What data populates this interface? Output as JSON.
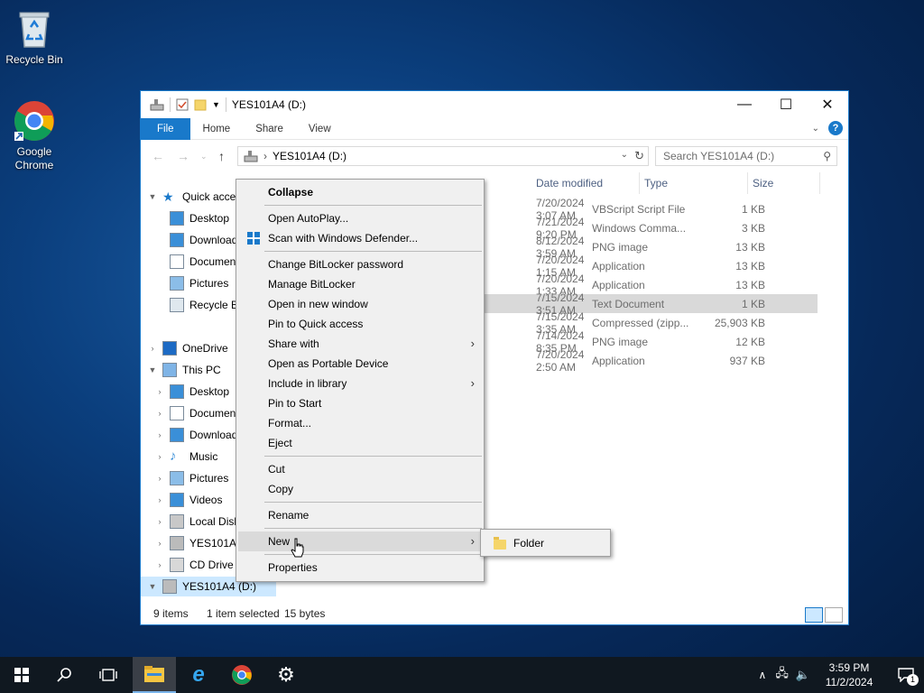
{
  "desktop": {
    "icons": [
      {
        "label": "Recycle Bin",
        "icon": "recycle-bin-icon"
      },
      {
        "label": "Google Chrome",
        "icon": "chrome-icon"
      }
    ]
  },
  "window": {
    "title": "YES101A4 (D:)",
    "tabs": [
      "File",
      "Home",
      "Share",
      "View"
    ],
    "address": "YES101A4 (D:)",
    "search_placeholder": "Search YES101A4 (D:)",
    "columns": {
      "date": "Date modified",
      "type": "Type",
      "size": "Size"
    },
    "files": [
      {
        "date": "7/20/2024 3:07 AM",
        "type": "VBScript Script File",
        "size": "1 KB"
      },
      {
        "date": "7/21/2024 9:20 PM",
        "type": "Windows Comma...",
        "size": "3 KB"
      },
      {
        "date": "8/12/2024 3:59 AM",
        "type": "PNG image",
        "size": "13 KB"
      },
      {
        "date": "7/20/2024 1:15 AM",
        "type": "Application",
        "size": "13 KB"
      },
      {
        "date": "7/20/2024 1:33 AM",
        "type": "Application",
        "size": "13 KB"
      },
      {
        "date": "7/15/2024 3:51 AM",
        "type": "Text Document",
        "size": "1 KB",
        "selected": true
      },
      {
        "date": "7/15/2024 3:35 AM",
        "type": "Compressed (zipp...",
        "size": "25,903 KB"
      },
      {
        "date": "7/14/2024 8:35 PM",
        "type": "PNG image",
        "size": "12 KB"
      },
      {
        "date": "7/20/2024 2:50 AM",
        "type": "Application",
        "size": "937 KB"
      }
    ],
    "nav": [
      {
        "label": "Quick access",
        "level": 0,
        "arrow": "▼",
        "icon": "star-icon"
      },
      {
        "label": "Desktop",
        "level": 1,
        "arrow": "",
        "icon": "desktop-icon"
      },
      {
        "label": "Downloads",
        "level": 1,
        "arrow": "",
        "icon": "download-icon"
      },
      {
        "label": "Documents",
        "level": 1,
        "arrow": "",
        "icon": "document-icon"
      },
      {
        "label": "Pictures",
        "level": 1,
        "arrow": "",
        "icon": "pictures-icon"
      },
      {
        "label": "Recycle Bin",
        "level": 1,
        "arrow": "",
        "icon": "recycle-bin-icon"
      },
      {
        "label": "",
        "level": 0,
        "arrow": "",
        "icon": ""
      },
      {
        "label": "OneDrive",
        "level": 0,
        "arrow": "›",
        "icon": "onedrive-icon"
      },
      {
        "label": "This PC",
        "level": 0,
        "arrow": "▼",
        "icon": "pc-icon"
      },
      {
        "label": "Desktop",
        "level": 1,
        "arrow": "›",
        "icon": "desktop-icon"
      },
      {
        "label": "Documents",
        "level": 1,
        "arrow": "›",
        "icon": "document-icon"
      },
      {
        "label": "Downloads",
        "level": 1,
        "arrow": "›",
        "icon": "download-icon"
      },
      {
        "label": "Music",
        "level": 1,
        "arrow": "›",
        "icon": "music-icon"
      },
      {
        "label": "Pictures",
        "level": 1,
        "arrow": "›",
        "icon": "pictures-icon"
      },
      {
        "label": "Videos",
        "level": 1,
        "arrow": "›",
        "icon": "videos-icon"
      },
      {
        "label": "Local Disk (C:)",
        "level": 1,
        "arrow": "›",
        "icon": "drive-icon"
      },
      {
        "label": "YES101A4 (D:)",
        "level": 1,
        "arrow": "›",
        "icon": "usb-drive-icon"
      },
      {
        "label": "CD Drive (E:)",
        "level": 1,
        "arrow": "›",
        "icon": "cd-drive-icon"
      },
      {
        "label": "YES101A4 (D:)",
        "level": 0,
        "arrow": "▼",
        "icon": "usb-drive-icon",
        "selected": true
      }
    ],
    "status": {
      "count": "9 items",
      "selected": "1 item selected",
      "size": "15 bytes"
    }
  },
  "context_menu": {
    "items": [
      {
        "label": "Collapse",
        "bold": true
      },
      {
        "sep": true
      },
      {
        "label": "Open AutoPlay..."
      },
      {
        "label": "Scan with Windows Defender...",
        "icon": "defender-shield-icon"
      },
      {
        "sep": true
      },
      {
        "label": "Change BitLocker password"
      },
      {
        "label": "Manage BitLocker"
      },
      {
        "label": "Open in new window"
      },
      {
        "label": "Pin to Quick access"
      },
      {
        "label": "Share with",
        "submenu": true
      },
      {
        "label": "Open as Portable Device"
      },
      {
        "label": "Include in library",
        "submenu": true
      },
      {
        "label": "Pin to Start"
      },
      {
        "label": "Format..."
      },
      {
        "label": "Eject"
      },
      {
        "sep": true
      },
      {
        "label": "Cut"
      },
      {
        "label": "Copy"
      },
      {
        "sep": true
      },
      {
        "label": "Rename"
      },
      {
        "sep": true
      },
      {
        "label": "New",
        "submenu": true,
        "highlighted": true
      },
      {
        "sep": true
      },
      {
        "label": "Properties"
      }
    ],
    "new_submenu": [
      {
        "label": "Folder",
        "icon": "folder-icon"
      }
    ]
  },
  "taskbar": {
    "time": "3:59 PM",
    "date": "11/2/2024",
    "notification_count": "1"
  },
  "colors": {
    "accent": "#1979ca",
    "selection": "#cce8ff"
  }
}
